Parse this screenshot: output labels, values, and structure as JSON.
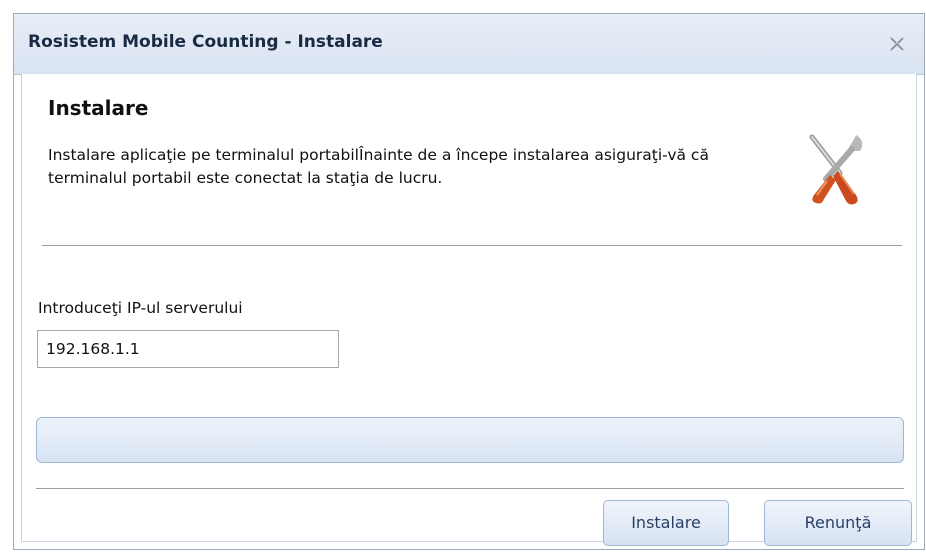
{
  "window": {
    "title": "Rosistem Mobile Counting - Instalare",
    "close_icon": "close-icon"
  },
  "header": {
    "title": "Instalare",
    "description": "Instalare aplicaţie pe terminalul portabilÎnainte de a începe instalarea asiguraţi-vă că terminalul portabil este conectat la staţia de lucru.",
    "icon": "tools-icon"
  },
  "form": {
    "ip_label": "Introduceţi IP-ul serverului",
    "ip_value": "192.168.1.1"
  },
  "progress": {
    "value": 0
  },
  "buttons": {
    "install_label": "Instalare",
    "cancel_label": "Renunţă"
  }
}
